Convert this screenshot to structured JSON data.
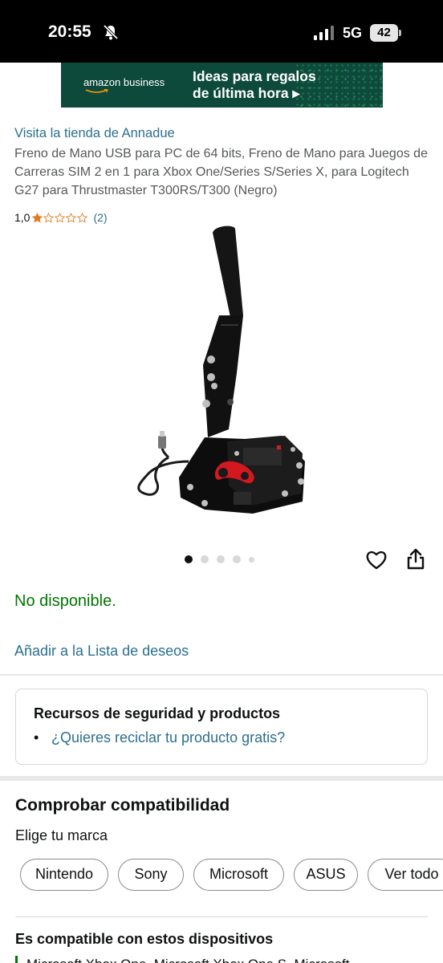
{
  "status_bar": {
    "time": "20:55",
    "network": "5G",
    "battery": "42"
  },
  "banner": {
    "brand": "amazon business",
    "title_line1": "Ideas para regalos",
    "title_line2": "de última hora ▸"
  },
  "product": {
    "store_link": "Visita la tienda de Annadue",
    "title": "Freno de Mano USB para PC de 64 bits, Freno de Mano para Juegos de Carreras SIM 2 en 1 para Xbox One/Series S/Series X, para Logitech G27 para Thrustmaster T300RS/T300 (Negro)",
    "rating_value": "1,0",
    "rating_stars": 1,
    "rating_count": "(2)",
    "image_count": 5,
    "image_active_index": 0,
    "availability": "No disponible.",
    "wishlist_link": "Añadir a la Lista de deseos"
  },
  "safety": {
    "title": "Recursos de seguridad y productos",
    "bullet": "•",
    "link": "¿Quieres reciclar tu producto gratis?"
  },
  "compatibility": {
    "title": "Comprobar compatibilidad",
    "brand_label": "Elige tu marca",
    "brands": [
      "Nintendo",
      "Sony",
      "Microsoft",
      "ASUS",
      "Ver todo"
    ],
    "devices_title": "Es compatible con estos dispositivos",
    "devices_text": "Microsoft Xbox One, Microsoft Xbox One S, Microsoft"
  },
  "colors": {
    "link": "#2a6f8f",
    "availability": "#007600",
    "star": "#de7921",
    "banner_bg": "#0e4a3c"
  },
  "icons": {
    "bell": "bell-slash-icon",
    "signal": "signal-icon",
    "battery": "battery-icon",
    "heart": "heart-icon",
    "share": "share-icon"
  }
}
